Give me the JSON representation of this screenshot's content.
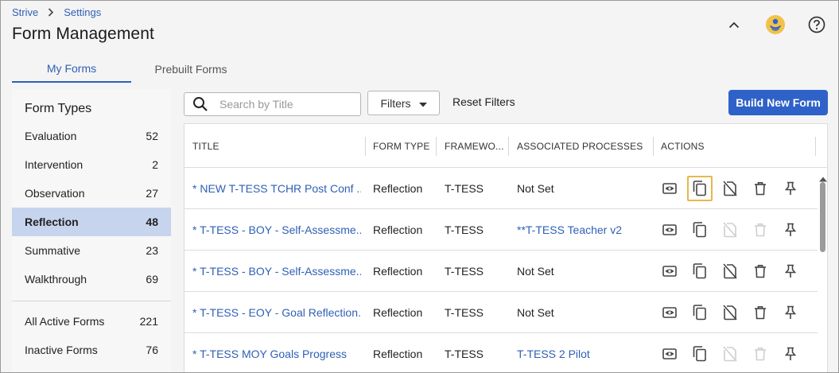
{
  "breadcrumb": {
    "root": "Strive",
    "current": "Settings"
  },
  "page": {
    "title": "Form Management"
  },
  "header_icons": [
    "chevron-up-icon",
    "user-avatar-icon",
    "help-icon"
  ],
  "tabs": [
    {
      "label": "My Forms",
      "active": true
    },
    {
      "label": "Prebuilt Forms",
      "active": false
    }
  ],
  "sidebar": {
    "heading": "Form Types",
    "items": [
      {
        "label": "Evaluation",
        "count": "52",
        "active": false
      },
      {
        "label": "Intervention",
        "count": "2",
        "active": false
      },
      {
        "label": "Observation",
        "count": "27",
        "active": false
      },
      {
        "label": "Reflection",
        "count": "48",
        "active": true
      },
      {
        "label": "Summative",
        "count": "23",
        "active": false
      },
      {
        "label": "Walkthrough",
        "count": "69",
        "active": false
      }
    ],
    "extra": [
      {
        "label": "All Active Forms",
        "count": "221"
      },
      {
        "label": "Inactive Forms",
        "count": "76"
      }
    ]
  },
  "toolbar": {
    "search_placeholder": "Search by Title",
    "filters_label": "Filters",
    "reset_label": "Reset Filters",
    "build_label": "Build New Form"
  },
  "table": {
    "columns": [
      "TITLE",
      "FORM TYPE",
      "FRAMEWO...",
      "ASSOCIATED PROCESSES",
      "ACTIONS"
    ],
    "rows": [
      {
        "title": "* NEW T-TESS TCHR Post Conf ...",
        "type": "Reflection",
        "framework": "T-TESS",
        "process": "Not Set",
        "process_link": false,
        "copy_highlighted": true,
        "disabled_actions": false
      },
      {
        "title": "* T-TESS - BOY - Self-Assessme...",
        "type": "Reflection",
        "framework": "T-TESS",
        "process": "**T-TESS Teacher v2",
        "process_link": true,
        "copy_highlighted": false,
        "disabled_actions": true
      },
      {
        "title": "* T-TESS - BOY - Self-Assessme...",
        "type": "Reflection",
        "framework": "T-TESS",
        "process": "Not Set",
        "process_link": false,
        "copy_highlighted": false,
        "disabled_actions": false
      },
      {
        "title": "* T-TESS - EOY - Goal Reflection...",
        "type": "Reflection",
        "framework": "T-TESS",
        "process": "Not Set",
        "process_link": false,
        "copy_highlighted": false,
        "disabled_actions": false
      },
      {
        "title": "* T-TESS MOY Goals Progress",
        "type": "Reflection",
        "framework": "T-TESS",
        "process": "T-TESS 2 Pilot",
        "process_link": true,
        "copy_highlighted": false,
        "disabled_actions": true
      }
    ],
    "action_icons": [
      "preview-icon",
      "copy-icon",
      "deactivate-icon",
      "delete-icon",
      "pin-icon"
    ]
  },
  "colors": {
    "accent": "#2f5fb5",
    "primary_button": "#2f62c8",
    "active_side_bg": "#c6d4ee",
    "highlight": "#e6b84c"
  }
}
